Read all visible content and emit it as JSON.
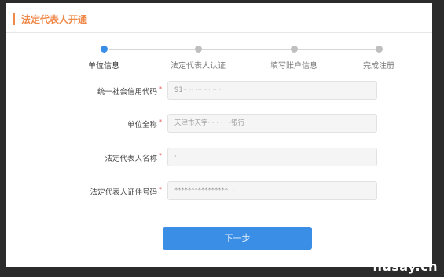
{
  "header": {
    "title": "法定代表人开通"
  },
  "steps": [
    {
      "label": "单位信息",
      "active": true
    },
    {
      "label": "法定代表人认证",
      "active": false
    },
    {
      "label": "填写账户信息",
      "active": false
    },
    {
      "label": "完成注册",
      "active": false
    }
  ],
  "form": {
    "credit_code": {
      "label": "统一社会信用代码",
      "value": "91·· ·· ··· ··· ·· ·"
    },
    "unit_name": {
      "label": "单位全称",
      "value": "天津市天宇· · · · · ·银行"
    },
    "rep_name": {
      "label": "法定代表人名称",
      "value": "·"
    },
    "rep_id": {
      "label": "法定代表人证件号码",
      "value": "****************· ·"
    }
  },
  "next_button": {
    "label": "下一步"
  },
  "watermark": {
    "text": "husay.cn"
  }
}
